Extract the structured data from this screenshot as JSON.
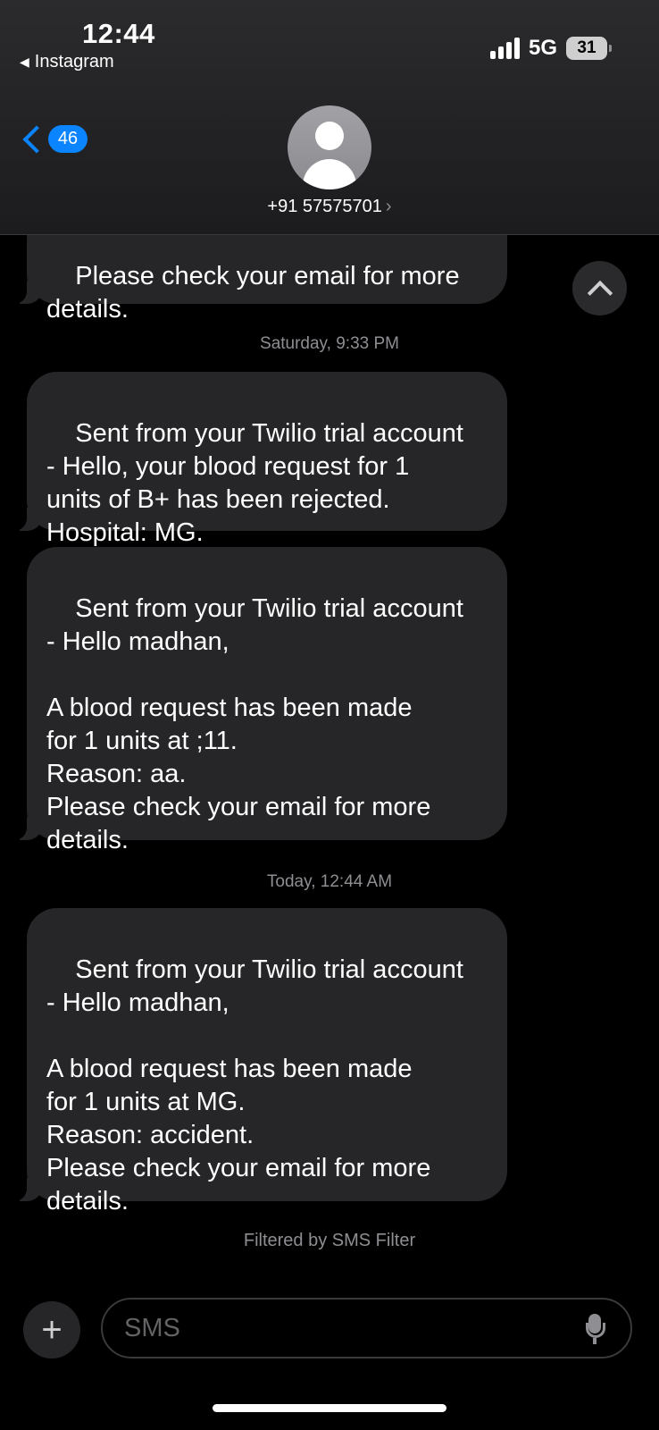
{
  "status_bar": {
    "time": "12:44",
    "back_app": "Instagram",
    "network": "5G",
    "battery": "31"
  },
  "header": {
    "unread_count": "46",
    "contact": "+91 57575701"
  },
  "messages": [
    {
      "text": "Please check your email for more\ndetails."
    },
    {
      "text": "Sent from your Twilio trial account\n- Hello, your blood request for 1\nunits of B+ has been rejected.\nHospital: MG."
    },
    {
      "text": "Sent from your Twilio trial account\n- Hello madhan,\n\nA blood request has been made\nfor 1 units at ;11.\nReason: aa.\nPlease check your email for more\ndetails."
    },
    {
      "text": "Sent from your Twilio trial account\n- Hello madhan,\n\nA blood request has been made\nfor 1 units at MG.\nReason: accident.\nPlease check your email for more\ndetails."
    }
  ],
  "timestamps": [
    {
      "day": "Saturday,",
      "time": "9:33 PM"
    },
    {
      "day": "Today,",
      "time": "12:44 AM"
    }
  ],
  "filter_note": "Filtered by SMS Filter",
  "composer": {
    "placeholder": "SMS",
    "plus": "+"
  }
}
